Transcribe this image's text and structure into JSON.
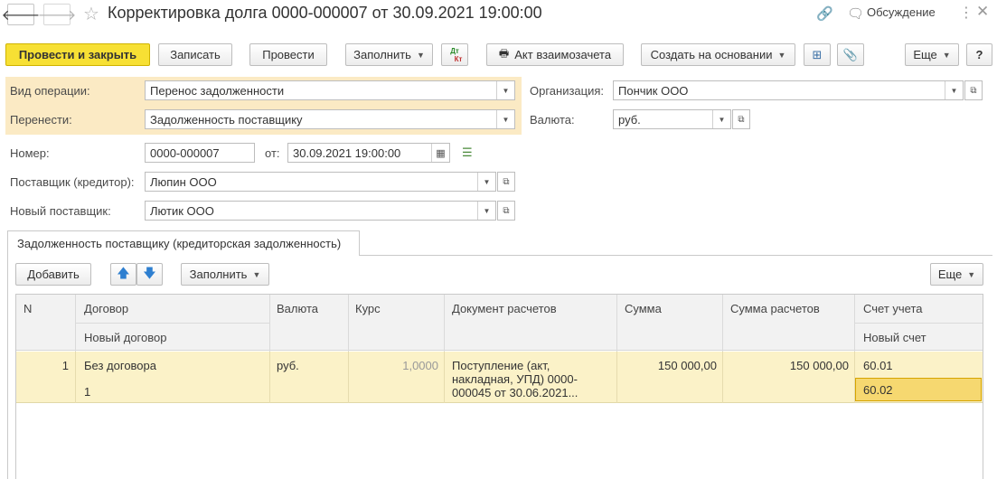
{
  "window": {
    "title": "Корректировка долга 0000-000007 от 30.09.2021 19:00:00",
    "discussion_label": "Обсуждение",
    "icons": {
      "back": "arrow-left-icon",
      "forward": "arrow-right-icon",
      "favorite": "star-icon",
      "link": "link-icon",
      "more": "more-icon",
      "close": "close-icon"
    }
  },
  "toolbar": {
    "post_close": "Провести и закрыть",
    "write": "Записать",
    "post": "Провести",
    "fill": "Заполнить",
    "dtkt_top": "Дт",
    "dtkt_bottom": "Кт",
    "netting_act": "Акт взаимозачета",
    "create_based": "Создать на основании",
    "more": "Еще",
    "help": "?"
  },
  "form": {
    "operation_label": "Вид операции:",
    "operation_value": "Перенос задолженности",
    "transfer_label": "Перенести:",
    "transfer_value": "Задолженность поставщику",
    "org_label": "Организация:",
    "org_value": "Пончик ООО",
    "currency_label": "Валюта:",
    "currency_value": "руб.",
    "number_label": "Номер:",
    "number_value": "0000-000007",
    "date_label": "от:",
    "date_value": "30.09.2021 19:00:00",
    "supplier_label": "Поставщик (кредитор):",
    "supplier_value": "Люпин ООО",
    "new_supplier_label": "Новый поставщик:",
    "new_supplier_value": "Лютик ООО"
  },
  "tab": {
    "label": "Задолженность поставщику (кредиторская задолженность)",
    "add": "Добавить",
    "fill": "Заполнить",
    "more": "Еще"
  },
  "table": {
    "headers": {
      "n": "N",
      "contract": "Договор",
      "new_contract": "Новый договор",
      "currency": "Валюта",
      "rate": "Курс",
      "doc": "Документ расчетов",
      "sum": "Сумма",
      "sum_settle": "Сумма расчетов",
      "account": "Счет учета",
      "new_account": "Новый счет"
    },
    "rows": [
      {
        "n": "1",
        "contract": "Без договора",
        "new_contract": "1",
        "currency": "руб.",
        "rate": "1,0000",
        "doc": "Поступление (акт, накладная, УПД) 0000-000045 от 30.06.2021...",
        "sum": "150 000,00",
        "sum_settle": "150 000,00",
        "account": "60.01",
        "new_account": "60.02"
      }
    ]
  }
}
